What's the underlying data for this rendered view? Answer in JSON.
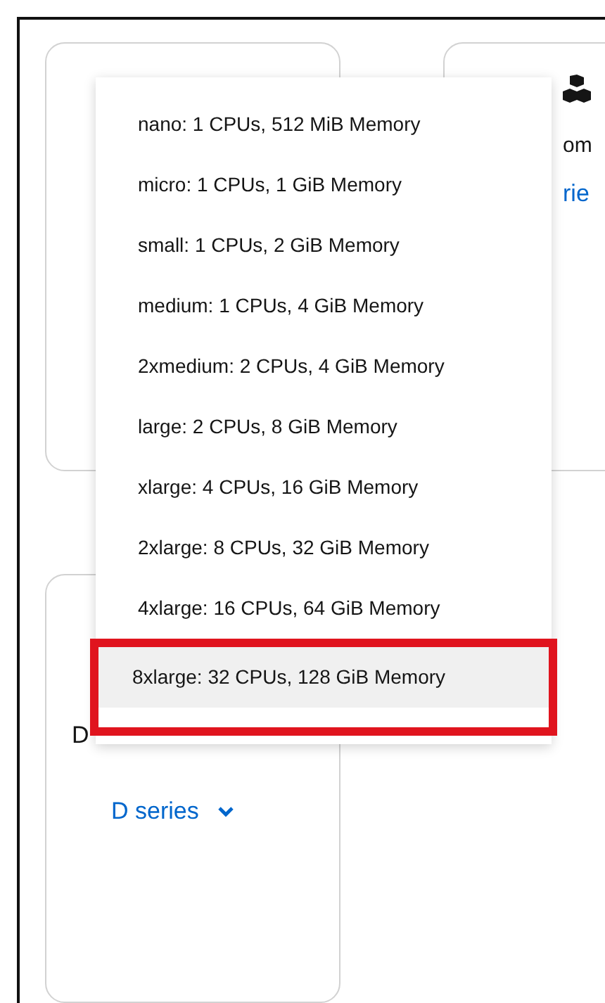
{
  "right_card": {
    "description": "om",
    "link": "rie"
  },
  "bottom_card": {
    "title": "D",
    "link": "D series"
  },
  "menu": {
    "items": [
      {
        "label": "nano: 1 CPUs, 512 MiB Memory",
        "selected": false,
        "highlighted": false
      },
      {
        "label": "micro: 1 CPUs, 1 GiB Memory",
        "selected": false,
        "highlighted": false
      },
      {
        "label": "small: 1 CPUs, 2 GiB Memory",
        "selected": false,
        "highlighted": false
      },
      {
        "label": "medium: 1 CPUs, 4 GiB Memory",
        "selected": false,
        "highlighted": false
      },
      {
        "label": "2xmedium: 2 CPUs, 4 GiB Memory",
        "selected": false,
        "highlighted": false
      },
      {
        "label": "large: 2 CPUs, 8 GiB Memory",
        "selected": false,
        "highlighted": false
      },
      {
        "label": "xlarge: 4 CPUs, 16 GiB Memory",
        "selected": false,
        "highlighted": false
      },
      {
        "label": "2xlarge: 8 CPUs, 32 GiB Memory",
        "selected": false,
        "highlighted": false
      },
      {
        "label": "4xlarge: 16 CPUs, 64 GiB Memory",
        "selected": false,
        "highlighted": false
      },
      {
        "label": "8xlarge: 32 CPUs, 128 GiB Memory",
        "selected": true,
        "highlighted": true
      }
    ]
  }
}
